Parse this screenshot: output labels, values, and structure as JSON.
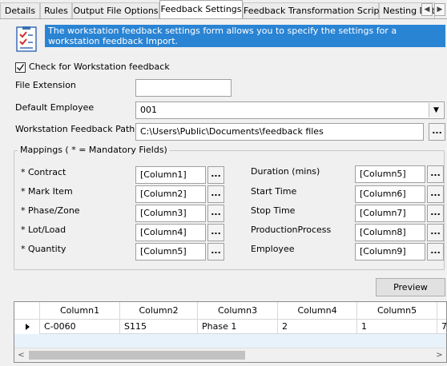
{
  "tabs": [
    {
      "label": "Details"
    },
    {
      "label": "Rules"
    },
    {
      "label": "Output File Options"
    },
    {
      "label": "Feedback Settings",
      "active": true
    },
    {
      "label": "Feedback Transformation Script"
    },
    {
      "label": "Nesting Det"
    }
  ],
  "info": {
    "text": "The workstation feedback settings form allows you to specify the settings for a workstation feedback Import.",
    "icon": "checklist-icon",
    "background": "#2a84d4"
  },
  "check_feedback": {
    "label": "Check for Workstation feedback",
    "checked": true
  },
  "file_extension": {
    "label": "File Extension",
    "value": ""
  },
  "default_employee": {
    "label": "Default Employee",
    "value": "001"
  },
  "feedback_path": {
    "label": "Workstation Feedback Path",
    "value": "C:\\Users\\Public\\Documents\\feedback files",
    "browse": "..."
  },
  "mappings": {
    "title": "Mappings  ( * = Mandatory Fields)",
    "left": [
      {
        "label": "* Contract",
        "value": "[Column1]",
        "browse": "..."
      },
      {
        "label": "* Mark Item",
        "value": "[Column2]",
        "browse": "..."
      },
      {
        "label": "* Phase/Zone",
        "value": "[Column3]",
        "browse": "..."
      },
      {
        "label": "* Lot/Load",
        "value": "[Column4]",
        "browse": "..."
      },
      {
        "label": "* Quantity",
        "value": "[Column5]",
        "browse": "..."
      }
    ],
    "right": [
      {
        "label": "Duration (mins)",
        "value": "[Column5]",
        "browse": "..."
      },
      {
        "label": "Start Time",
        "value": "[Column6]",
        "browse": "..."
      },
      {
        "label": "Stop Time",
        "value": "[Column7]",
        "browse": "..."
      },
      {
        "label": "ProductionProcess",
        "value": "[Column8]",
        "browse": "..."
      },
      {
        "label": "Employee",
        "value": "[Column9]",
        "browse": "..."
      }
    ]
  },
  "preview_button": "Preview",
  "grid": {
    "columns": [
      "Column1",
      "Column2",
      "Column3",
      "Column4",
      "Column5"
    ],
    "rows": [
      [
        "C-0060",
        "S115",
        "Phase 1",
        "2",
        "1",
        "7"
      ]
    ],
    "selected_row_color": "#e8f2fb"
  }
}
